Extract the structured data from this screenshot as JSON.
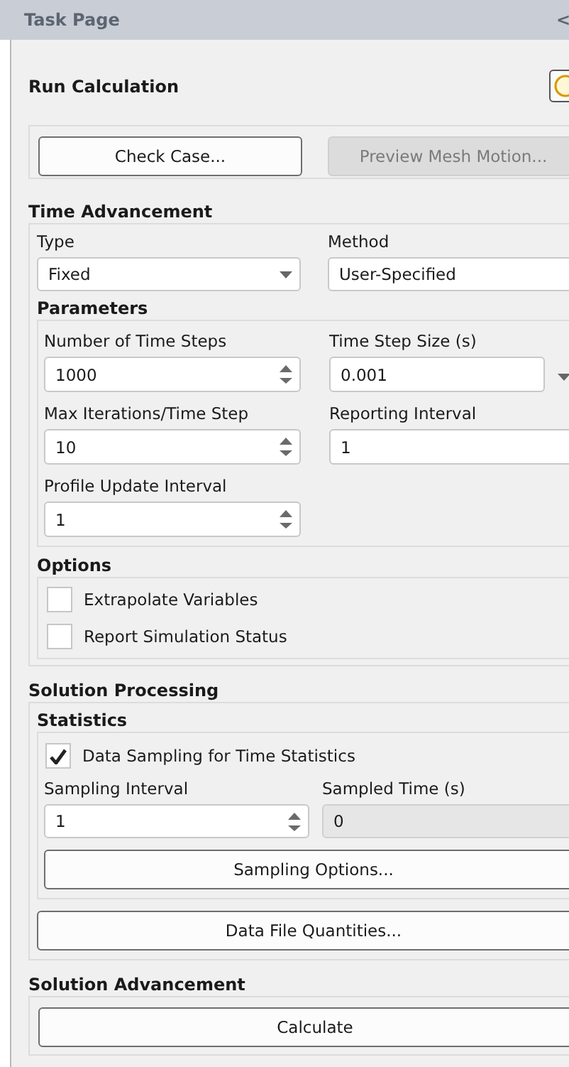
{
  "header": {
    "title": "Task Page",
    "collapse_glyph": "<"
  },
  "page": {
    "title": "Run Calculation"
  },
  "top_buttons": [
    {
      "label": "Check Case...",
      "disabled": false
    },
    {
      "label": "Preview Mesh Motion...",
      "disabled": true
    }
  ],
  "time_advancement": {
    "title": "Time Advancement",
    "type": {
      "label": "Type",
      "value": "Fixed"
    },
    "method": {
      "label": "Method",
      "value": "User-Specified"
    },
    "parameters": {
      "title": "Parameters",
      "fields": [
        {
          "label": "Number of Time Steps",
          "value": "1000",
          "kind": "spinner"
        },
        {
          "label": "Time Step Size (s)",
          "value": "0.001",
          "kind": "text-units"
        },
        {
          "label": "Max Iterations/Time Step",
          "value": "10",
          "kind": "spinner"
        },
        {
          "label": "Reporting Interval",
          "value": "1",
          "kind": "text"
        },
        {
          "label": "Profile Update Interval",
          "value": "1",
          "kind": "spinner"
        }
      ]
    },
    "options": {
      "title": "Options",
      "items": [
        {
          "label": "Extrapolate Variables",
          "checked": false
        },
        {
          "label": "Report Simulation Status",
          "checked": false
        }
      ]
    }
  },
  "solution_processing": {
    "title": "Solution Processing",
    "statistics": {
      "title": "Statistics",
      "sampling": {
        "label": "Data Sampling for Time Statistics",
        "checked": true
      },
      "fields": [
        {
          "label": "Sampling Interval",
          "value": "1",
          "kind": "spinner",
          "disabled": false
        },
        {
          "label": "Sampled Time (s)",
          "value": "0",
          "kind": "text",
          "disabled": true
        }
      ],
      "button": "Sampling Options..."
    },
    "button": "Data File Quantities..."
  },
  "solution_advancement": {
    "title": "Solution Advancement",
    "button": "Calculate"
  }
}
